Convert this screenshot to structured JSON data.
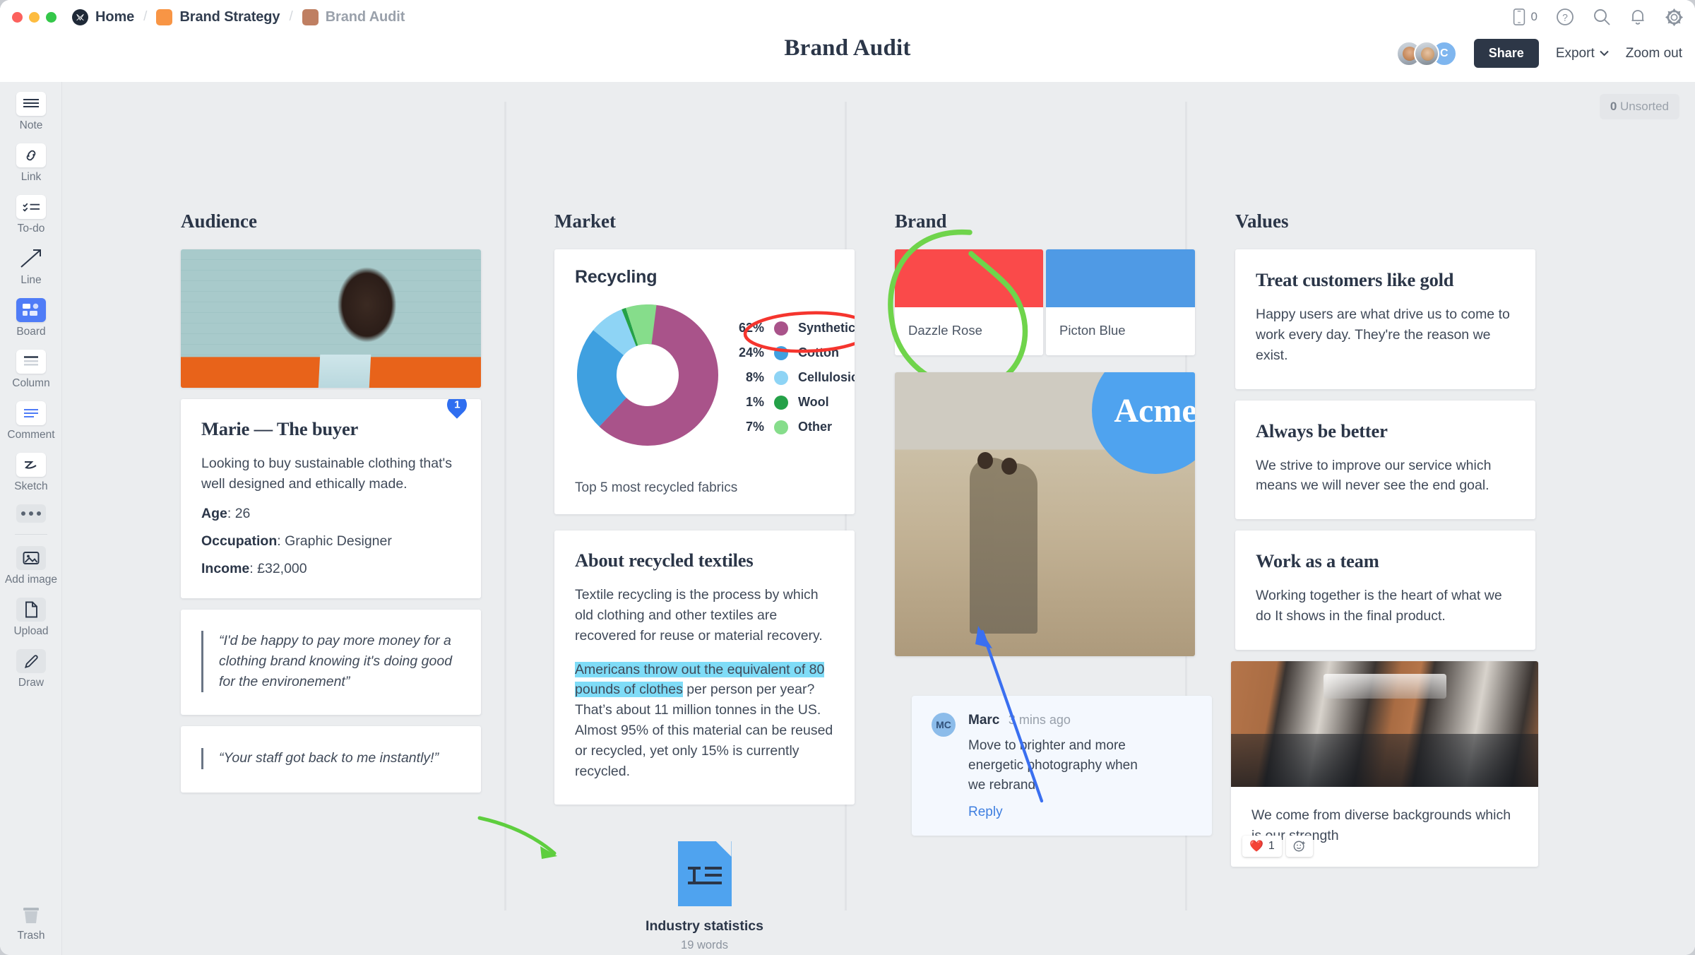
{
  "titlebar": {
    "breadcrumbs": [
      {
        "label": "Home",
        "icon": "milanote-logo-icon",
        "color": "#1f2937"
      },
      {
        "label": "Brand Strategy",
        "icon": "board-color-swatch",
        "color": "#f89545"
      },
      {
        "label": "Brand Audit",
        "icon": "board-color-swatch",
        "color": "#bf7f62"
      }
    ],
    "icons": [
      {
        "name": "mobile-icon",
        "count": "0"
      },
      {
        "name": "help-icon"
      },
      {
        "name": "search-icon"
      },
      {
        "name": "notifications-bell-icon"
      },
      {
        "name": "settings-gear-icon"
      }
    ]
  },
  "header": {
    "title": "Brand Audit",
    "avatar_initial": "C",
    "share_label": "Share",
    "export_label": "Export",
    "zoom_label": "Zoom out"
  },
  "sidebar": {
    "tools": [
      {
        "label": "Note",
        "icon": "note-icon",
        "style": "white"
      },
      {
        "label": "Link",
        "icon": "link-icon",
        "style": "white"
      },
      {
        "label": "To-do",
        "icon": "todo-icon",
        "style": "white"
      },
      {
        "label": "Line",
        "icon": "line-arrow-icon",
        "style": "plain"
      },
      {
        "label": "Board",
        "icon": "board-icon",
        "style": "active"
      },
      {
        "label": "Column",
        "icon": "column-icon",
        "style": "white"
      },
      {
        "label": "Comment",
        "icon": "comment-icon",
        "style": "white"
      },
      {
        "label": "Sketch",
        "icon": "sketch-icon",
        "style": "white"
      }
    ],
    "more_label": "more-options-icon",
    "tools2": [
      {
        "label": "Add image",
        "icon": "add-image-icon",
        "style": "flat"
      },
      {
        "label": "Upload",
        "icon": "upload-file-icon",
        "style": "flat"
      },
      {
        "label": "Draw",
        "icon": "draw-pencil-icon",
        "style": "flat"
      }
    ],
    "trash_label": "Trash",
    "trash_icon": "trash-icon"
  },
  "canvas": {
    "unsorted_count": "0",
    "unsorted_label": "Unsorted"
  },
  "columns": [
    {
      "title": "Audience"
    },
    {
      "title": "Market"
    },
    {
      "title": "Brand"
    },
    {
      "title": "Values"
    }
  ],
  "audience": {
    "photo_alt": "woman-in-orange-blazer-photo",
    "persona": {
      "title": "Marie — The buyer",
      "description": "Looking to buy sustainable clothing that's well designed and ethically made.",
      "fields": [
        {
          "key": "Age",
          "value": "26"
        },
        {
          "key": "Occupation",
          "value": "Graphic Designer"
        },
        {
          "key": "Income",
          "value": "£32,000"
        }
      ],
      "comment_pin_count": "1"
    },
    "quotes": [
      "“I'd be happy to pay more money for a clothing brand knowing it's doing good for the environement”",
      "“Your staff got back to me instantly!”"
    ]
  },
  "market": {
    "chart_card": {
      "title": "Recycling",
      "caption": "Top 5 most recycled fabrics"
    },
    "article": {
      "title": "About recycled textiles",
      "p1": "Textile recycling is the process by which old clothing and other textiles are recovered for reuse or material recovery.",
      "p2_highlight": "Americans throw out the equivalent of 80 pounds of clothes",
      "p2_rest": " per person per year? That’s about 11 million tonnes in the US. Almost 95% of this material can be reused or recycled, yet only 15% is currently recycled."
    },
    "file": {
      "name": "Industry statistics",
      "meta": "19 words",
      "icon": "text-document-icon"
    }
  },
  "brand": {
    "swatches": [
      {
        "name": "Dazzle Rose",
        "color": "#fa4a4a"
      },
      {
        "name": "Picton Blue",
        "color": "#4f9ae5"
      }
    ],
    "logo": {
      "text": "Acme",
      "color": "#4fa3ef"
    },
    "photo_alt": "two-people-in-desert-photo",
    "comment": {
      "initials": "MC",
      "author": "Marc",
      "time": "3 mins ago",
      "body": "Move to brighter and more energetic photography when we rebrand.",
      "reply_label": "Reply"
    }
  },
  "values": {
    "cards": [
      {
        "title": "Treat customers like gold",
        "body": "Happy users are what drive us to come to work every day. They're the reason we exist."
      },
      {
        "title": "Always be better",
        "body": "We strive to improve our service which means we will never see the end goal."
      },
      {
        "title": "Work as a team",
        "body": "Working together is the heart of what we do It shows in the final product."
      }
    ],
    "photo_card": {
      "photo_alt": "team-meeting-around-table-photo",
      "caption": "We come from diverse backgrounds which is our strength",
      "reaction_emoji": "❤️",
      "reaction_count": "1",
      "add_reaction_icon": "add-reaction-icon"
    }
  },
  "annotations": {
    "green_circle_color": "#6fd44b",
    "green_arrow_color": "#5ece3e",
    "red_circle_color": "#f5352e",
    "blue_arrow_color": "#3a6ff0"
  },
  "chart_data": {
    "type": "pie",
    "title": "Recycling",
    "subtitle": "Top 5 most recycled fabrics",
    "donut": true,
    "legend_position": "right",
    "labels": [
      "Synthetics",
      "Cotton",
      "Cellulosics",
      "Wool",
      "Other"
    ],
    "values": [
      62,
      24,
      8,
      1,
      7
    ],
    "value_labels": [
      "62%",
      "24%",
      "8%",
      "1%",
      "7%"
    ],
    "colors": [
      "#a9538a",
      "#3fa0e0",
      "#8ed4f5",
      "#24a148",
      "#86dd8b"
    ],
    "highlighted": "Synthetics"
  }
}
